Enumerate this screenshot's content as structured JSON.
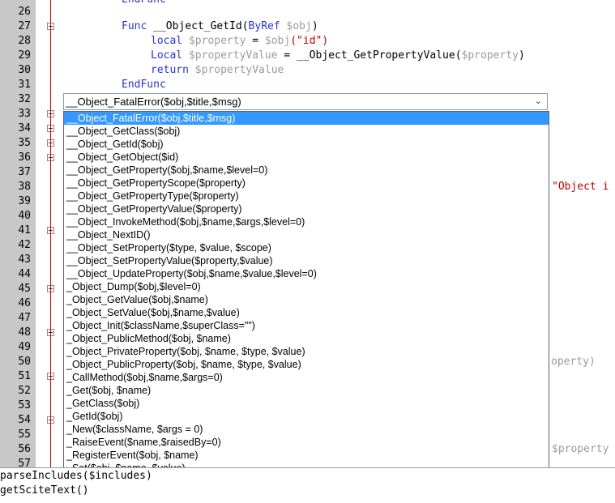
{
  "line_numbers": [
    "26",
    "27",
    "28",
    "29",
    "30",
    "31",
    "32",
    "33",
    "34",
    "35",
    "36",
    "37",
    "38",
    "39",
    "40",
    "41",
    "42",
    "43",
    "44",
    "45",
    "46",
    "47",
    "48",
    "49",
    "50",
    "51",
    "52",
    "53",
    "54",
    "55",
    "56",
    "57"
  ],
  "code": {
    "l27_kw1": "Func",
    "l27_fn": " __Object_GetId(",
    "l27_kw2": "ByRef",
    "l27_var": " $obj",
    "l27_close": ")",
    "l28_kw": "local",
    "l28_var1": " $property",
    "l28_op": " = ",
    "l28_var2": "$obj",
    "l28_p1": "(",
    "l28_str": "\"id\"",
    "l28_p2": ")",
    "l29_kw": "Local",
    "l29_var1": " $propertyValue",
    "l29_op": " = ",
    "l29_fn": "__Object_GetPropertyValue(",
    "l29_var2": "$property",
    "l29_close": ")",
    "l30_kw": "return",
    "l30_var": " $propertyValue",
    "l31_kw": "EndFunc",
    "right38": "\"Object i",
    "right50": "operty)",
    "right56": "$property"
  },
  "combo": {
    "value": "__Object_FatalError($obj,$title,$msg)",
    "arrow": "⌄"
  },
  "autocomplete": {
    "items": [
      "__Object_FatalError($obj,$title,$msg)",
      "__Object_GetClass($obj)",
      "__Object_GetId($obj)",
      "__Object_GetObject($id)",
      "__Object_GetProperty($obj,$name,$level=0)",
      "__Object_GetPropertyScope($property)",
      "__Object_GetPropertyType($property)",
      "__Object_GetPropertyValue($property)",
      "__Object_InvokeMethod($obj,$name,$args,$level=0)",
      "__Object_NextID()",
      "__Object_SetProperty($type, $value, $scope)",
      "__Object_SetPropertyValue($property,$value)",
      "__Object_UpdateProperty($obj,$name,$value,$level=0)",
      "_Object_Dump($obj,$level=0)",
      "_Object_GetValue($obj,$name)",
      "_Object_SetValue($obj,$name,$value)",
      "_Object_Init($className,$superClass=\"\")",
      "_Object_PublicMethod($obj, $name)",
      "_Object_PrivateProperty($obj, $name, $type, $value)",
      "_Object_PublicProperty($obj, $name, $type, $value)",
      "_CallMethod($obj,$name,$args=0)",
      "_Get($obj, $name)",
      "_GetClass($obj)",
      "_GetId($obj)",
      "_New($className, $args = 0)",
      "_RaiseEvent($name,$raisedBy=0)",
      "_RegisterEvent($obj, $name)",
      "_Set($obj, $name, $value)"
    ],
    "selected_index": 0
  },
  "output": {
    "line1": "parseIncludes($includes)",
    "line2": "getSciteText()"
  },
  "colors": {
    "keyword": "#2a35c9",
    "variable": "#9b9b9b",
    "string": "#c00000",
    "selection": "#3399ff",
    "gutter": "#c8c8c8",
    "fold_line": "#d00000"
  },
  "icons": {
    "fold_marker": "fold-collapse-icon",
    "dropdown": "chevron-down-icon"
  }
}
